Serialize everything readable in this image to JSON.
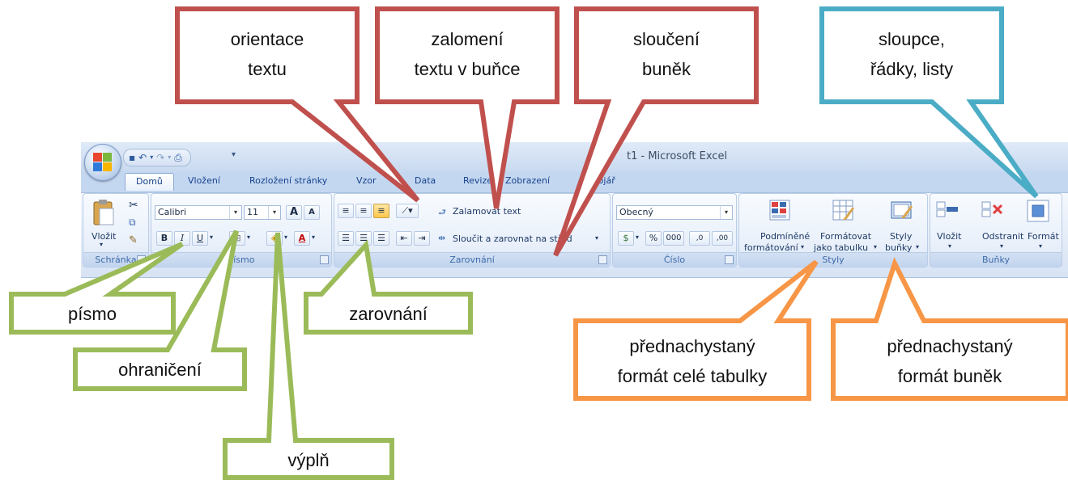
{
  "window": {
    "title": "t1 - Microsoft Excel"
  },
  "tabs": [
    "Domů",
    "Vložení",
    "Rozložení stránky",
    "Vzor",
    "Data",
    "Revize",
    "Zobrazení",
    "Vojář"
  ],
  "clipboard": {
    "paste_label": "Vložit",
    "group_label": "Schránka"
  },
  "font": {
    "family": "Calibri",
    "size": "11",
    "bold": "B",
    "italic": "I",
    "underline": "U",
    "grow": "A",
    "shrink": "A",
    "group_label": "Písmo"
  },
  "alignment": {
    "wrap_text": "Zalamovat text",
    "merge_center": "Sloučit a zarovnat na střed",
    "group_label": "Zarovnání"
  },
  "number": {
    "format": "Obecný",
    "percent": "%",
    "thousands": "000",
    "inc_dec": ",0",
    "dec_dec": ",00",
    "group_label": "Číslo"
  },
  "styles": {
    "conditional_line1": "Podmíněné",
    "conditional_line2": "formátování",
    "table_line1": "Formátovat",
    "table_line2": "jako tabulku",
    "cell_line1": "Styly",
    "cell_line2": "buňky",
    "group_label": "Styly"
  },
  "cells": {
    "insert": "Vložit",
    "delete": "Odstranit",
    "format": "Formát",
    "group_label": "Buňky"
  },
  "callouts": {
    "orientace": {
      "line1": "orientace",
      "line2": "textu"
    },
    "zalomeni": {
      "line1": "zalomení",
      "line2": "textu v buňce"
    },
    "slouceni": {
      "line1": "sloučení",
      "line2": "buněk"
    },
    "sloupce": {
      "line1": "sloupce,",
      "line2": "řádky,  listy"
    },
    "pismo": "písmo",
    "ohraniceni": "ohraničení",
    "vypln": "výplň",
    "zarovnani": "zarovnání",
    "format_tabulky": {
      "line1": "přednachystaný",
      "line2": "formát celé tabulky"
    },
    "format_bunek": {
      "line1": "přednachystaný",
      "line2": "formát buněk"
    }
  },
  "colors": {
    "red": "#c0504d",
    "blue": "#4bacc6",
    "green": "#9bbb59",
    "orange": "#f79646"
  }
}
